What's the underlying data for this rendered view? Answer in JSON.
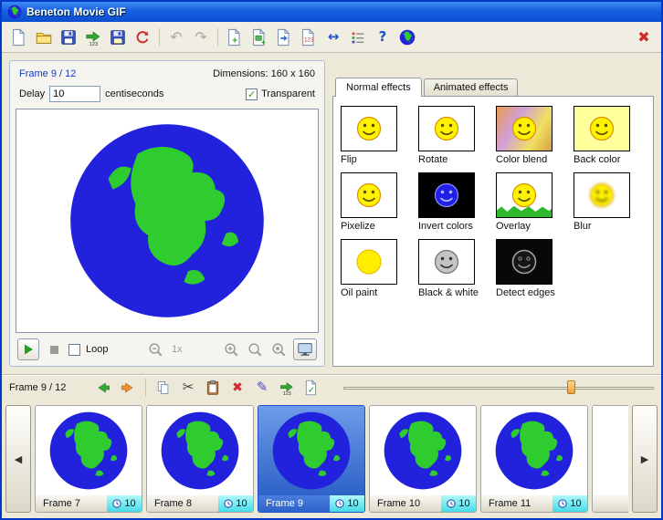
{
  "window": {
    "title": "Beneton Movie GIF"
  },
  "toolbar": {
    "icons": [
      "new-file",
      "open-file",
      "save",
      "export-frames",
      "save-frames-123",
      "refresh",
      "undo",
      "redo",
      "add-frame",
      "add-frame-from-file",
      "add-frame-from-clipboard",
      "add-frames-123",
      "resize",
      "frame-list",
      "help",
      "website",
      "close"
    ]
  },
  "editor": {
    "frame_label": "Frame 9 / 12",
    "dimensions": "Dimensions: 160 x 160",
    "delay_label": "Delay",
    "delay_value": "10",
    "delay_unit": "centiseconds",
    "transparent_label": "Transparent",
    "transparent_checked": true,
    "loop_label": "Loop",
    "loop_checked": false,
    "zoom_label": "1x"
  },
  "effects": {
    "tabs": [
      {
        "label": "Normal effects",
        "active": true
      },
      {
        "label": "Animated effects",
        "active": false
      }
    ],
    "items": [
      {
        "label": "Flip"
      },
      {
        "label": "Rotate"
      },
      {
        "label": "Color blend"
      },
      {
        "label": "Back color"
      },
      {
        "label": "Pixelize"
      },
      {
        "label": "Invert colors"
      },
      {
        "label": "Overlay"
      },
      {
        "label": "Blur"
      },
      {
        "label": "Oil paint"
      },
      {
        "label": "Black & white"
      },
      {
        "label": "Detect edges"
      }
    ]
  },
  "frame_toolbar": {
    "label": "Frame 9 / 12",
    "icons": [
      "back",
      "forward",
      "copy",
      "cut",
      "paste",
      "delete",
      "edit",
      "export-123",
      "apply-check"
    ],
    "slider_value": 72
  },
  "filmstrip": {
    "frames": [
      {
        "label": "Frame 7",
        "delay": "10",
        "selected": false
      },
      {
        "label": "Frame 8",
        "delay": "10",
        "selected": false
      },
      {
        "label": "Frame 9",
        "delay": "10",
        "selected": true
      },
      {
        "label": "Frame 10",
        "delay": "10",
        "selected": false
      },
      {
        "label": "Frame 11",
        "delay": "10",
        "selected": false
      }
    ]
  },
  "colors": {
    "titlebar_top": "#3C8CF0",
    "titlebar_bottom": "#0B4FD0",
    "window_bg": "#ECE9D8",
    "selected_frame_blue": "#2E62C8",
    "delay_badge_cyan": "#44DCE8",
    "frame_label_blue": "#1140C0",
    "globe_sea": "#2222DD",
    "globe_land": "#2ECC2E"
  }
}
